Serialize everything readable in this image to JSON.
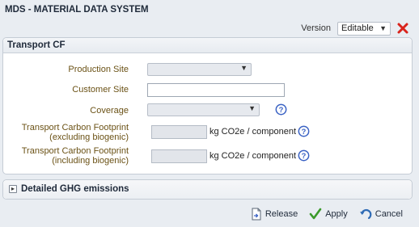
{
  "app": {
    "title": "MDS - MATERIAL DATA SYSTEM"
  },
  "version": {
    "label": "Version",
    "value": "Editable"
  },
  "panel": {
    "title": "Transport CF",
    "production_site_label": "Production Site",
    "customer_site_label": "Customer Site",
    "coverage_label": "Coverage",
    "tcf_excl_label_line1": "Transport Carbon Footprint",
    "tcf_excl_label_line2": "(excluding biogenic)",
    "tcf_incl_label_line1": "Transport Carbon Footprint",
    "tcf_incl_label_line2": "(including biogenic)",
    "unit": "kg CO2e / component",
    "production_site_value": "",
    "customer_site_value": "",
    "coverage_value": "",
    "tcf_excl_value": "",
    "tcf_incl_value": ""
  },
  "ghg": {
    "title": "Detailed GHG emissions"
  },
  "actions": {
    "release": "Release",
    "apply": "Apply",
    "cancel": "Cancel"
  },
  "colors": {
    "label": "#6b5216",
    "help": "#3a62c4",
    "close": "#d9241c",
    "apply": "#3a9a2a"
  }
}
